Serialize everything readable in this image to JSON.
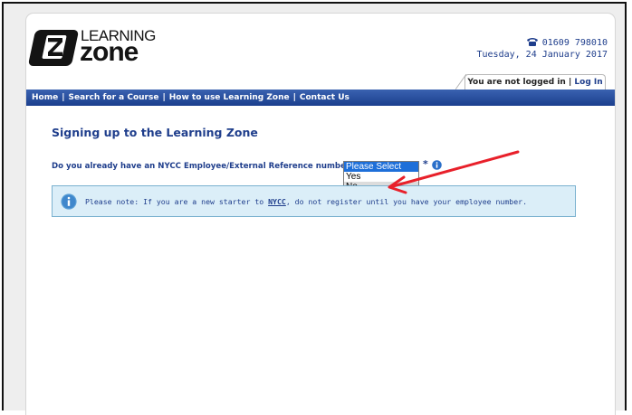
{
  "brand": {
    "logo_top": "LEARNING",
    "logo_bottom": "zone"
  },
  "contact": {
    "phone": "01609 798010",
    "date": "Tuesday, 24 January 2017"
  },
  "login": {
    "status": "You are not logged in",
    "separator": " | ",
    "link": "Log In"
  },
  "nav": {
    "items": [
      {
        "label": "Home"
      },
      {
        "label": "Search for a Course"
      },
      {
        "label": "How to use Learning Zone"
      },
      {
        "label": "Contact Us"
      }
    ],
    "separator": "|"
  },
  "page_title": "Signing up to the Learning Zone",
  "form": {
    "question": "Do you already have an NYCC Employee/External Reference number?",
    "required_mark": "*",
    "options": [
      "Please Select",
      "Yes",
      "No"
    ],
    "selected": "Please Select",
    "hovered": "No"
  },
  "notice": {
    "prefix": "Please note: If you are a new starter to ",
    "link": "NYCC",
    "suffix": ", do not register until you have your employee number."
  },
  "colors": {
    "accent": "#1f3e8c",
    "nav_bg": "#1b3f8e",
    "notice_bg": "#dbeef8",
    "annotation_arrow": "#e8202a"
  },
  "icons": {
    "phone": "phone-icon",
    "info": "info-icon"
  }
}
